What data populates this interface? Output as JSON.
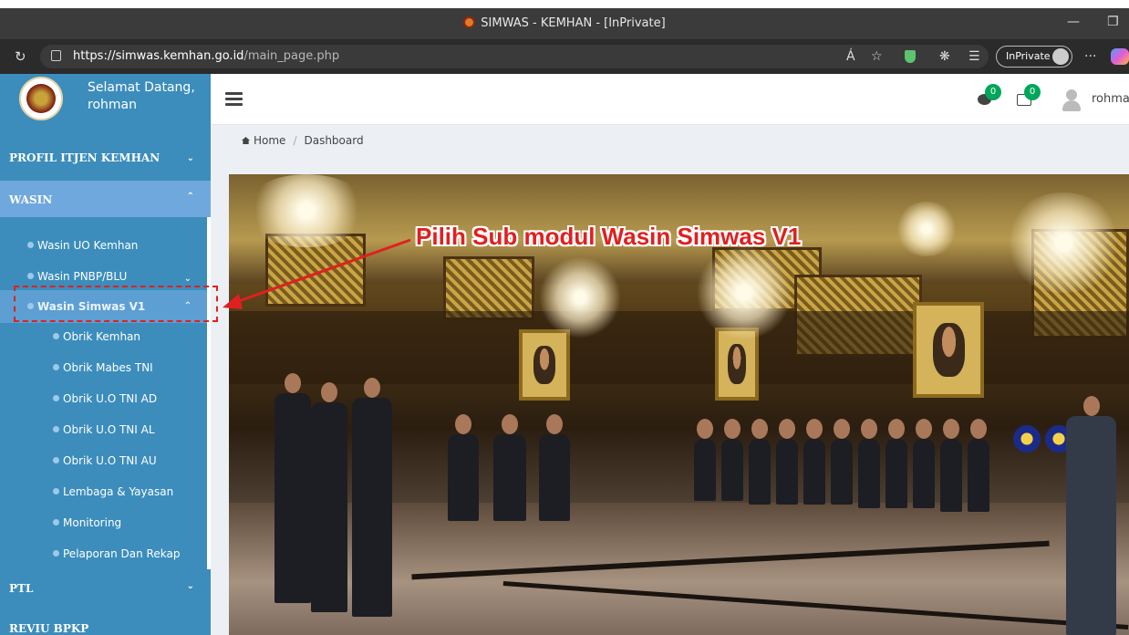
{
  "browser": {
    "title": "SIMWAS - KEMHAN - [InPrivate]",
    "url_host": "https://simwas.kemhan.go.id",
    "url_path": "/main_page.php",
    "inprivate_label": "InPrivate",
    "read_aloud": "Á",
    "more": "···"
  },
  "sidebar": {
    "welcome_line1": "Selamat Datang,",
    "welcome_line2": "rohman",
    "profil": "PROFIL ITJEN KEMHAN",
    "wasin": "WASIN",
    "sub_items": [
      {
        "label": "Wasin UO Kemhan"
      },
      {
        "label": "Wasin PNBP/BLU"
      },
      {
        "label": "Wasin Simwas V1"
      }
    ],
    "v1_items": [
      {
        "label": "Obrik Kemhan"
      },
      {
        "label": "Obrik Mabes TNI"
      },
      {
        "label": "Obrik U.O TNI AD"
      },
      {
        "label": "Obrik U.O TNI AL"
      },
      {
        "label": "Obrik U.O TNI AU"
      },
      {
        "label": "Lembaga & Yayasan"
      },
      {
        "label": "Monitoring"
      },
      {
        "label": "Pelaporan Dan Rekap"
      }
    ],
    "ptl": "PTL",
    "reviu": "REVIU BPKP"
  },
  "header": {
    "messages_count": "0",
    "notifications_count": "0",
    "user": "rohman"
  },
  "breadcrumb": {
    "home": "Home",
    "current": "Dashboard"
  },
  "annotation": {
    "text": "Pilih Sub modul Wasin Simwas V1",
    "color": "#e02020"
  },
  "colors": {
    "sidebar_bg": "#3c8dbc",
    "sidebar_active": "#6fa8dc",
    "badge": "#00a65a"
  }
}
